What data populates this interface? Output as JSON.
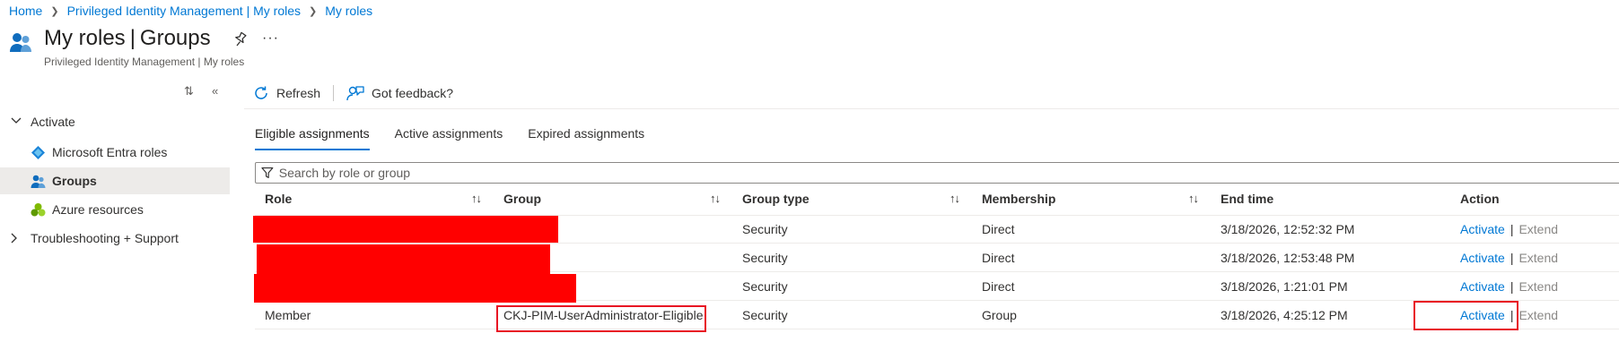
{
  "breadcrumb": [
    {
      "label": "Home"
    },
    {
      "label": "Privileged Identity Management | My roles"
    },
    {
      "label": "My roles"
    }
  ],
  "header": {
    "title_main": "My roles",
    "title_sep": "|",
    "title_sub": "Groups",
    "subtitle": "Privileged Identity Management | My roles",
    "more_label": "···"
  },
  "sidebar": {
    "items": [
      {
        "label": "Activate",
        "icon": "chevron-down-icon",
        "expanded": true
      },
      {
        "label": "Microsoft Entra roles",
        "icon": "entra-diamond-icon"
      },
      {
        "label": "Groups",
        "icon": "groups-icon",
        "selected": true
      },
      {
        "label": "Azure resources",
        "icon": "azure-resources-icon"
      },
      {
        "label": "Troubleshooting + Support",
        "icon": "chevron-right-icon",
        "expanded": false
      }
    ]
  },
  "toolbar": {
    "refresh_label": "Refresh",
    "feedback_label": "Got feedback?"
  },
  "tabs": [
    {
      "label": "Eligible assignments",
      "active": true
    },
    {
      "label": "Active assignments"
    },
    {
      "label": "Expired assignments"
    }
  ],
  "search": {
    "placeholder": "Search by role or group",
    "value": ""
  },
  "table": {
    "columns": [
      "Role",
      "Group",
      "Group type",
      "Membership",
      "End time",
      "Action"
    ],
    "sort_symbol": "↑↓",
    "rows": [
      {
        "role": "",
        "group": "",
        "group_type": "Security",
        "membership": "Direct",
        "end_time": "3/18/2026, 12:52:32 PM",
        "action": "Activate",
        "action_sep": "|",
        "action2": "Extend",
        "redacted": true
      },
      {
        "role": "",
        "group": "",
        "group_type": "Security",
        "membership": "Direct",
        "end_time": "3/18/2026, 12:53:48 PM",
        "action": "Activate",
        "action_sep": "|",
        "action2": "Extend",
        "redacted": true
      },
      {
        "role": "",
        "group": "",
        "group_type": "Security",
        "membership": "Direct",
        "end_time": "3/18/2026, 1:21:01 PM",
        "action": "Activate",
        "action_sep": "|",
        "action2": "Extend",
        "redacted": true
      },
      {
        "role": "Member",
        "group": "CKJ-PIM-UserAdministrator-Eligible",
        "group_type": "Security",
        "membership": "Group",
        "end_time": "3/18/2026, 4:25:12 PM",
        "action": "Activate",
        "action_sep": "|",
        "action2": "Extend",
        "highlighted": true
      }
    ]
  },
  "colors": {
    "accent": "#0078d4",
    "redaction": "#ff0000",
    "highlight_border": "#e81123"
  }
}
